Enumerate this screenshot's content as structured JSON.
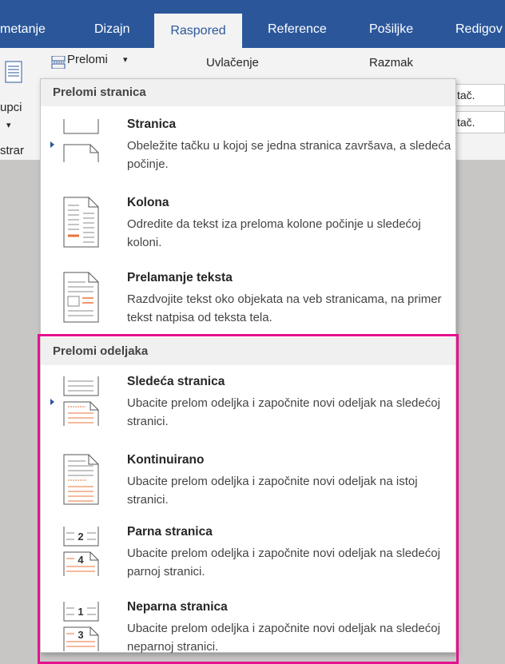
{
  "tabs": [
    {
      "label": "metanje"
    },
    {
      "label": "Dizajn"
    },
    {
      "label": "Raspored"
    },
    {
      "label": "Reference"
    },
    {
      "label": "Pošiljke"
    },
    {
      "label": "Redigov"
    }
  ],
  "ribbon": {
    "breaks_button": "Prelomi",
    "indent_label": "Uvlačenje",
    "spacing_label": "Razmak",
    "left_label_1": "upci",
    "left_label_2": "strar",
    "field_1": "tač.",
    "field_2": "tač."
  },
  "menu": {
    "page_breaks_header": "Prelomi stranica",
    "section_breaks_header": "Prelomi odeljaka",
    "items": [
      {
        "title": "Stranica",
        "desc": "Obeležite tačku u kojoj se jedna stranica završava, a sledeća počinje."
      },
      {
        "title": "Kolona",
        "desc": "Odredite da tekst iza preloma kolone počinje u sledećoj koloni."
      },
      {
        "title": "Prelamanje teksta",
        "desc": "Razdvojite tekst oko objekata na veb stranicama, na primer tekst natpisa od teksta tela."
      },
      {
        "title": "Sledeća stranica",
        "desc": "Ubacite prelom odeljka i započnite novi odeljak na sledećoj stranici."
      },
      {
        "title": "Kontinuirano",
        "desc": "Ubacite prelom odeljka i započnite novi odeljak na istoj stranici."
      },
      {
        "title": "Parna stranica",
        "desc": "Ubacite prelom odeljka i započnite novi odeljak na sledećoj parnoj stranici.",
        "icon_number": "2"
      },
      {
        "title": "Neparna stranica",
        "desc": "Ubacite prelom odeljka i započnite novi odeljak na sledećoj neparnoj stranici.",
        "icon_number": "3"
      }
    ],
    "odd_icon_top_number": "1",
    "even_icon_bottom_number": "4"
  },
  "colors": {
    "ribbon_blue": "#2b579a",
    "highlight_pink": "#e3118f",
    "icon_orange": "#e8743b"
  }
}
